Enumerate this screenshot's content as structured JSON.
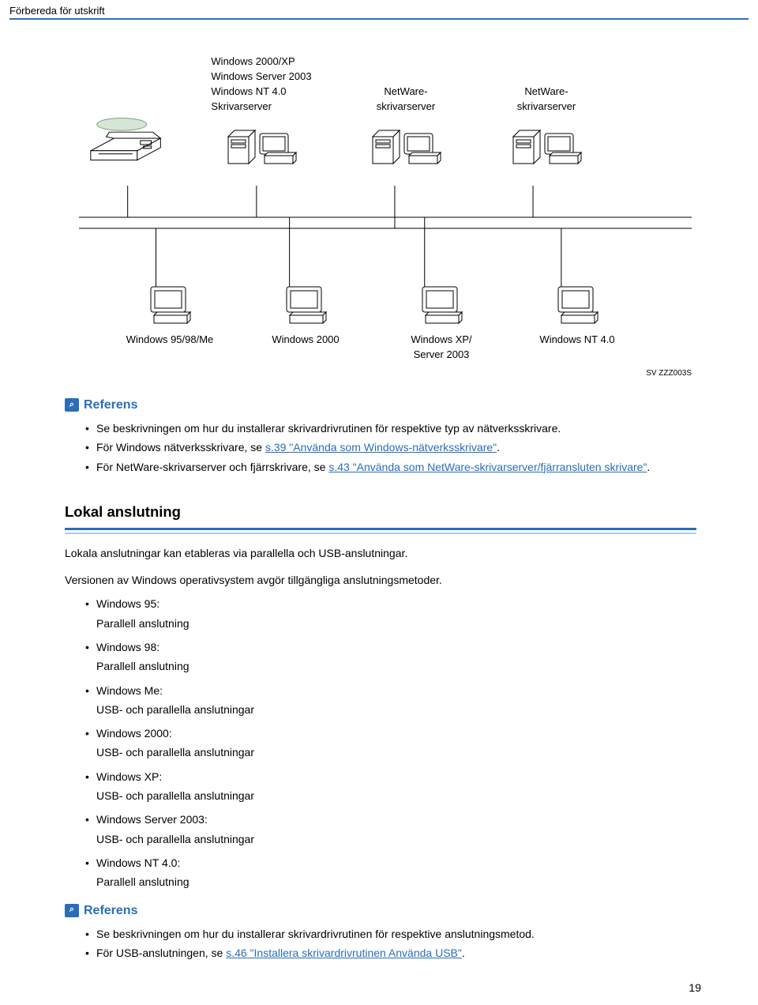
{
  "header": {
    "title": "Förbereda för utskrift"
  },
  "diagram": {
    "top_labels": {
      "server1_line1": "Windows 2000/XP",
      "server1_line2": "Windows Server 2003",
      "server1_line3": "Windows NT 4.0",
      "server1_line4": "Skrivarserver",
      "server2_line1": "NetWare-",
      "server2_line2": "skrivarserver",
      "server3_line1": "NetWare-",
      "server3_line2": "skrivarserver"
    },
    "clients": [
      {
        "label": "Windows 95/98/Me"
      },
      {
        "label": "Windows 2000"
      },
      {
        "label_line1": "Windows XP/",
        "label_line2": "Server 2003"
      },
      {
        "label": "Windows NT 4.0"
      }
    ],
    "figure_code": "SV ZZZ003S"
  },
  "reference_label": "Referens",
  "ref1_items": [
    {
      "text": "Se beskrivningen om hur du installerar skrivardrivrutinen för respektive typ av nätverksskrivare."
    },
    {
      "prefix": "För Windows nätverksskrivare, se ",
      "link": "s.39 \"Använda som Windows-nätverksskrivare\"",
      "suffix": "."
    },
    {
      "prefix": "För NetWare-skrivarserver och fjärrskrivare, se ",
      "link": "s.43 \"Använda som NetWare-skrivarserver/fjärransluten skrivare\"",
      "suffix": "."
    }
  ],
  "section": {
    "title": "Lokal anslutning",
    "para1": "Lokala anslutningar kan etableras via parallella och USB-anslutningar.",
    "para2": "Versionen av Windows operativsystem avgör tillgängliga anslutningsmetoder.",
    "bullets": [
      {
        "head": "Windows 95:",
        "sub": "Parallell anslutning"
      },
      {
        "head": "Windows 98:",
        "sub": "Parallell anslutning"
      },
      {
        "head": "Windows Me:",
        "sub": "USB- och parallella anslutningar"
      },
      {
        "head": "Windows 2000:",
        "sub": "USB- och parallella anslutningar"
      },
      {
        "head": "Windows XP:",
        "sub": "USB- och parallella anslutningar"
      },
      {
        "head": "Windows Server 2003:",
        "sub": "USB- och parallella anslutningar"
      },
      {
        "head": "Windows NT 4.0:",
        "sub": "Parallell anslutning"
      }
    ]
  },
  "ref2_items": [
    {
      "text": "Se beskrivningen om hur du installerar skrivardrivrutinen för respektive anslutningsmetod."
    },
    {
      "prefix": "För USB-anslutningen, se ",
      "link": "s.46 \"Installera skrivardrivrutinen Använda USB\"",
      "suffix": "."
    }
  ],
  "page_number": "19"
}
